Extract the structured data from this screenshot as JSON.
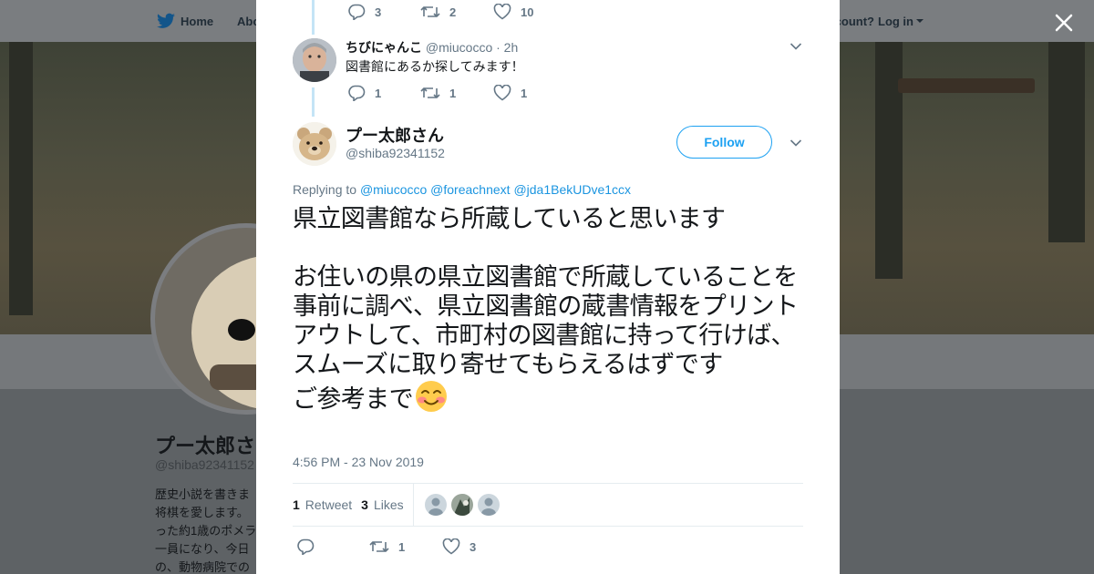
{
  "background": {
    "nav_home": "Home",
    "nav_about": "Abo",
    "account_prompt": "ccount?",
    "login_label": "Log in",
    "profile_name": "プー太郎さん",
    "profile_handle": "@shiba92341152",
    "bio_lines": [
      "歴史小説を書きま",
      "将棋を愛します。",
      "った約1歳のポメラ",
      "一員になり、今日",
      "の、動物病院での"
    ]
  },
  "parent_tweet": {
    "display_name": "ちびにゃんこ",
    "handle": "@miucocco",
    "time": "· 2h",
    "text": "図書館にあるか探してみます！",
    "replies": "1",
    "retweets": "1",
    "likes": "1"
  },
  "previous_actions": {
    "replies": "3",
    "retweets": "2",
    "likes": "10"
  },
  "main_tweet": {
    "display_name": "プー太郎さん",
    "handle": "@shiba92341152",
    "follow_label": "Follow",
    "replying_prefix": "Replying to",
    "mentions": [
      "@miucocco",
      "@foreachnext",
      "@jda1BekUDve1ccx"
    ],
    "text": "県立図書館なら所蔵していると思います\n\nお住いの県の県立図書館で所蔵していることを事前に調べ、県立図書館の蔵書情報をプリントアウトして、市町村の図書館に持って行けば、スムーズに取り寄せてもらえるはずです\nご参考まで",
    "emoji": "smiling-face-with-smiling-eyes-icon",
    "timestamp": "4:56 PM - 23 Nov 2019",
    "retweet_count": "1",
    "retweet_label": "Retweet",
    "like_count": "3",
    "like_label": "Likes",
    "footer_replies": "",
    "footer_retweets": "1",
    "footer_likes": "3"
  },
  "colors": {
    "twitter_blue": "#1da1f2",
    "mention_blue": "#1b95e0",
    "secondary_text": "#657786",
    "thread_line": "#c4e4f6"
  }
}
